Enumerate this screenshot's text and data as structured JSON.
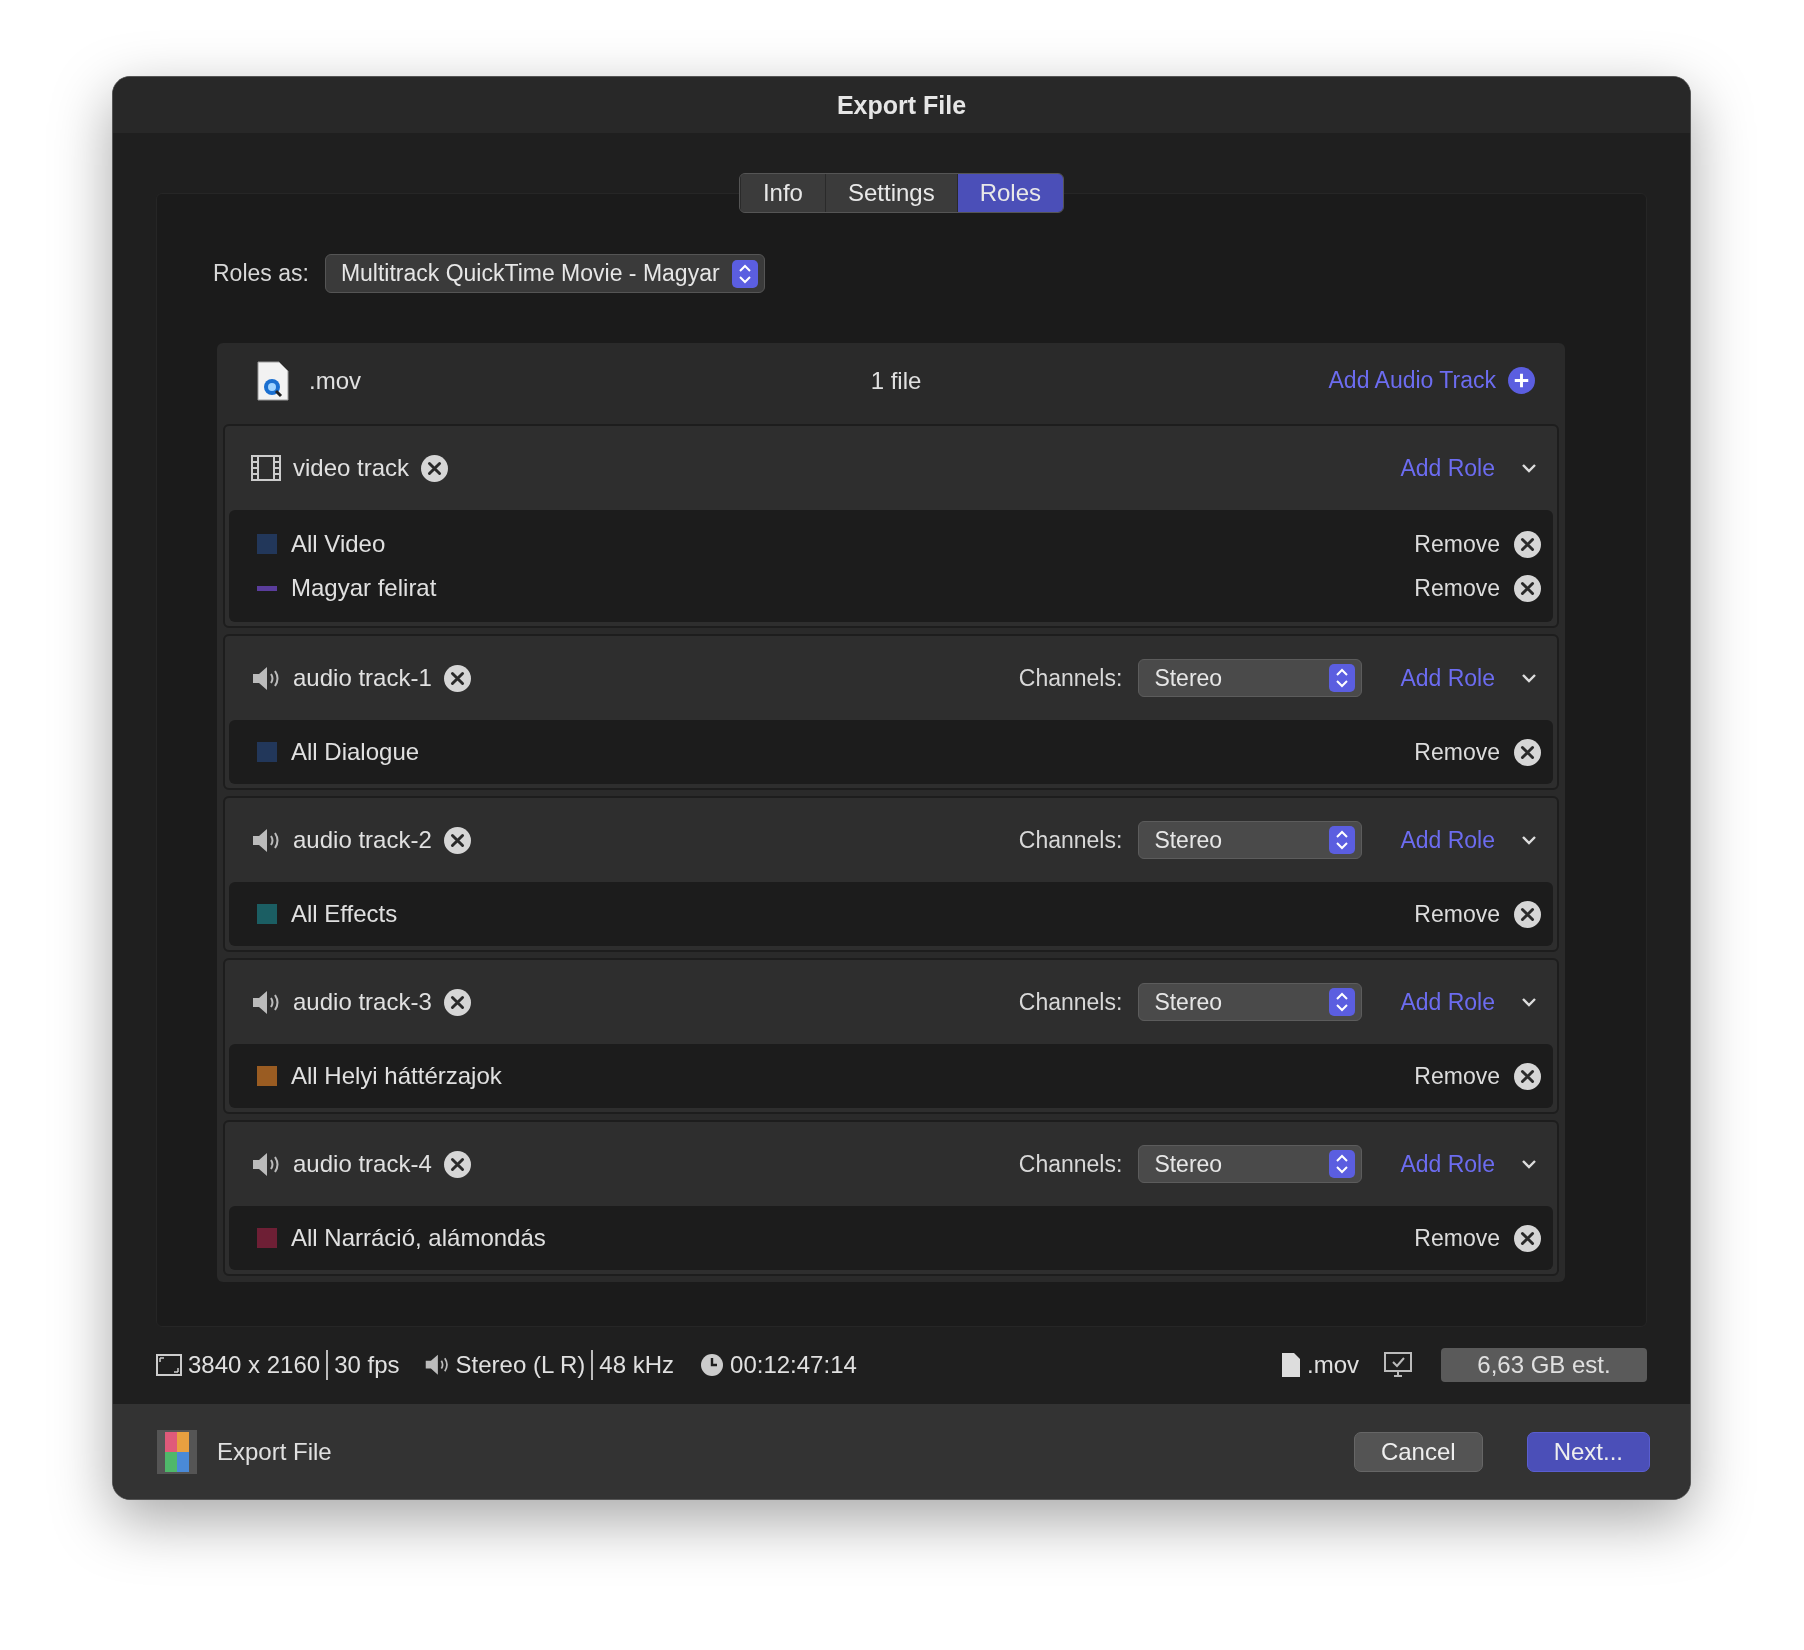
{
  "window": {
    "title": "Export File"
  },
  "tabs": [
    {
      "label": "Info",
      "selected": false
    },
    {
      "label": "Settings",
      "selected": false
    },
    {
      "label": "Roles",
      "selected": true
    }
  ],
  "roles_as": {
    "label": "Roles as:",
    "value": "Multitrack QuickTime Movie - Magyar"
  },
  "file_header": {
    "extension": ".mov",
    "count": "1 file",
    "add_audio_track": "Add Audio Track"
  },
  "tracks": [
    {
      "kind": "video",
      "name": "video track",
      "add_role": "Add Role",
      "roles": [
        {
          "kind": "swatch",
          "name": "All Video",
          "color": "#22375a",
          "remove": "Remove"
        },
        {
          "kind": "caption",
          "name": "Magyar felirat",
          "color": "#5a3d9c",
          "remove": "Remove"
        }
      ]
    },
    {
      "kind": "audio",
      "name": "audio track-1",
      "channels_label": "Channels:",
      "channels": "Stereo",
      "add_role": "Add Role",
      "roles": [
        {
          "kind": "swatch",
          "name": "All Dialogue",
          "color": "#22375a",
          "remove": "Remove"
        }
      ]
    },
    {
      "kind": "audio",
      "name": "audio track-2",
      "channels_label": "Channels:",
      "channels": "Stereo",
      "add_role": "Add Role",
      "roles": [
        {
          "kind": "swatch",
          "name": "All Effects",
          "color": "#1b5e63",
          "remove": "Remove"
        }
      ]
    },
    {
      "kind": "audio",
      "name": "audio track-3",
      "channels_label": "Channels:",
      "channels": "Stereo",
      "add_role": "Add Role",
      "roles": [
        {
          "kind": "swatch",
          "name": "All Helyi háttérzajok",
          "color": "#9a5c22",
          "remove": "Remove"
        }
      ]
    },
    {
      "kind": "audio",
      "name": "audio track-4",
      "channels_label": "Channels:",
      "channels": "Stereo",
      "add_role": "Add Role",
      "roles": [
        {
          "kind": "swatch",
          "name": "All Narráció, alámondás",
          "color": "#6e1f35",
          "remove": "Remove"
        }
      ]
    }
  ],
  "status_bar": {
    "resolution": "3840 x 2160",
    "frame_rate": "30 fps",
    "audio": "Stereo (L R)",
    "sample_rate": "48 kHz",
    "duration": "00:12:47:14",
    "file_type": ".mov",
    "size": "6,63 GB est."
  },
  "footer": {
    "title": "Export File",
    "buttons": [
      {
        "label": "Cancel",
        "kind": "secondary"
      },
      {
        "label": "Next...",
        "kind": "primary"
      }
    ]
  }
}
